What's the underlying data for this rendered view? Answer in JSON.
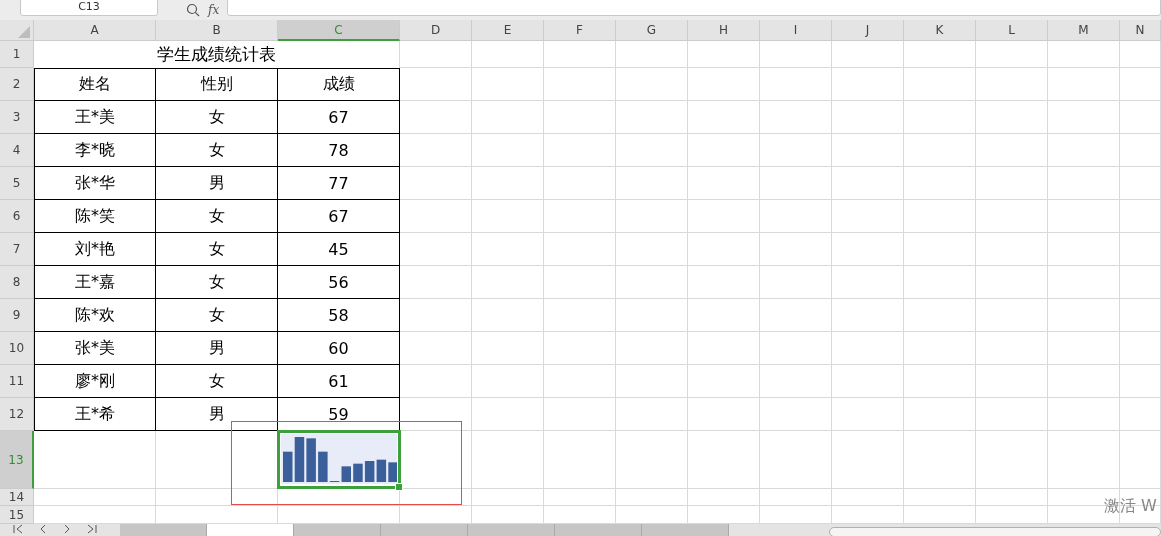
{
  "name_box": "C13",
  "formula_label": "fx",
  "columns": [
    {
      "label": "A",
      "selected": false
    },
    {
      "label": "B",
      "selected": false
    },
    {
      "label": "C",
      "selected": true
    },
    {
      "label": "D",
      "selected": false
    },
    {
      "label": "E",
      "selected": false
    },
    {
      "label": "F",
      "selected": false
    },
    {
      "label": "G",
      "selected": false
    },
    {
      "label": "H",
      "selected": false
    },
    {
      "label": "I",
      "selected": false
    },
    {
      "label": "J",
      "selected": false
    },
    {
      "label": "K",
      "selected": false
    },
    {
      "label": "L",
      "selected": false
    },
    {
      "label": "M",
      "selected": false
    },
    {
      "label": "N",
      "selected": false
    }
  ],
  "rows": [
    {
      "label": "1",
      "selected": false
    },
    {
      "label": "2",
      "selected": false
    },
    {
      "label": "3",
      "selected": false
    },
    {
      "label": "4",
      "selected": false
    },
    {
      "label": "5",
      "selected": false
    },
    {
      "label": "6",
      "selected": false
    },
    {
      "label": "7",
      "selected": false
    },
    {
      "label": "8",
      "selected": false
    },
    {
      "label": "9",
      "selected": false
    },
    {
      "label": "10",
      "selected": false
    },
    {
      "label": "11",
      "selected": false
    },
    {
      "label": "12",
      "selected": false
    },
    {
      "label": "13",
      "selected": true
    },
    {
      "label": "14",
      "selected": false
    },
    {
      "label": "15",
      "selected": false
    }
  ],
  "title": "学生成绩统计表",
  "headers": [
    "姓名",
    "性别",
    "成绩"
  ],
  "records": [
    {
      "name": "王*美",
      "gender": "女",
      "score": "67"
    },
    {
      "name": "李*晓",
      "gender": "女",
      "score": "78"
    },
    {
      "name": "张*华",
      "gender": "男",
      "score": "77"
    },
    {
      "name": "陈*笑",
      "gender": "女",
      "score": "67"
    },
    {
      "name": "刘*艳",
      "gender": "女",
      "score": "45"
    },
    {
      "name": "王*嘉",
      "gender": "女",
      "score": "56"
    },
    {
      "name": "陈*欢",
      "gender": "女",
      "score": "58"
    },
    {
      "name": "张*美",
      "gender": "男",
      "score": "60"
    },
    {
      "name": "廖*刚",
      "gender": "女",
      "score": "61"
    },
    {
      "name": "王*希",
      "gender": "男",
      "score": "59"
    }
  ],
  "sheet_tabs": [
    {
      "selected": false
    },
    {
      "selected": true
    },
    {
      "selected": false
    },
    {
      "selected": false
    },
    {
      "selected": false
    },
    {
      "selected": false
    },
    {
      "selected": false
    }
  ],
  "activation_notice": "激活 W"
}
